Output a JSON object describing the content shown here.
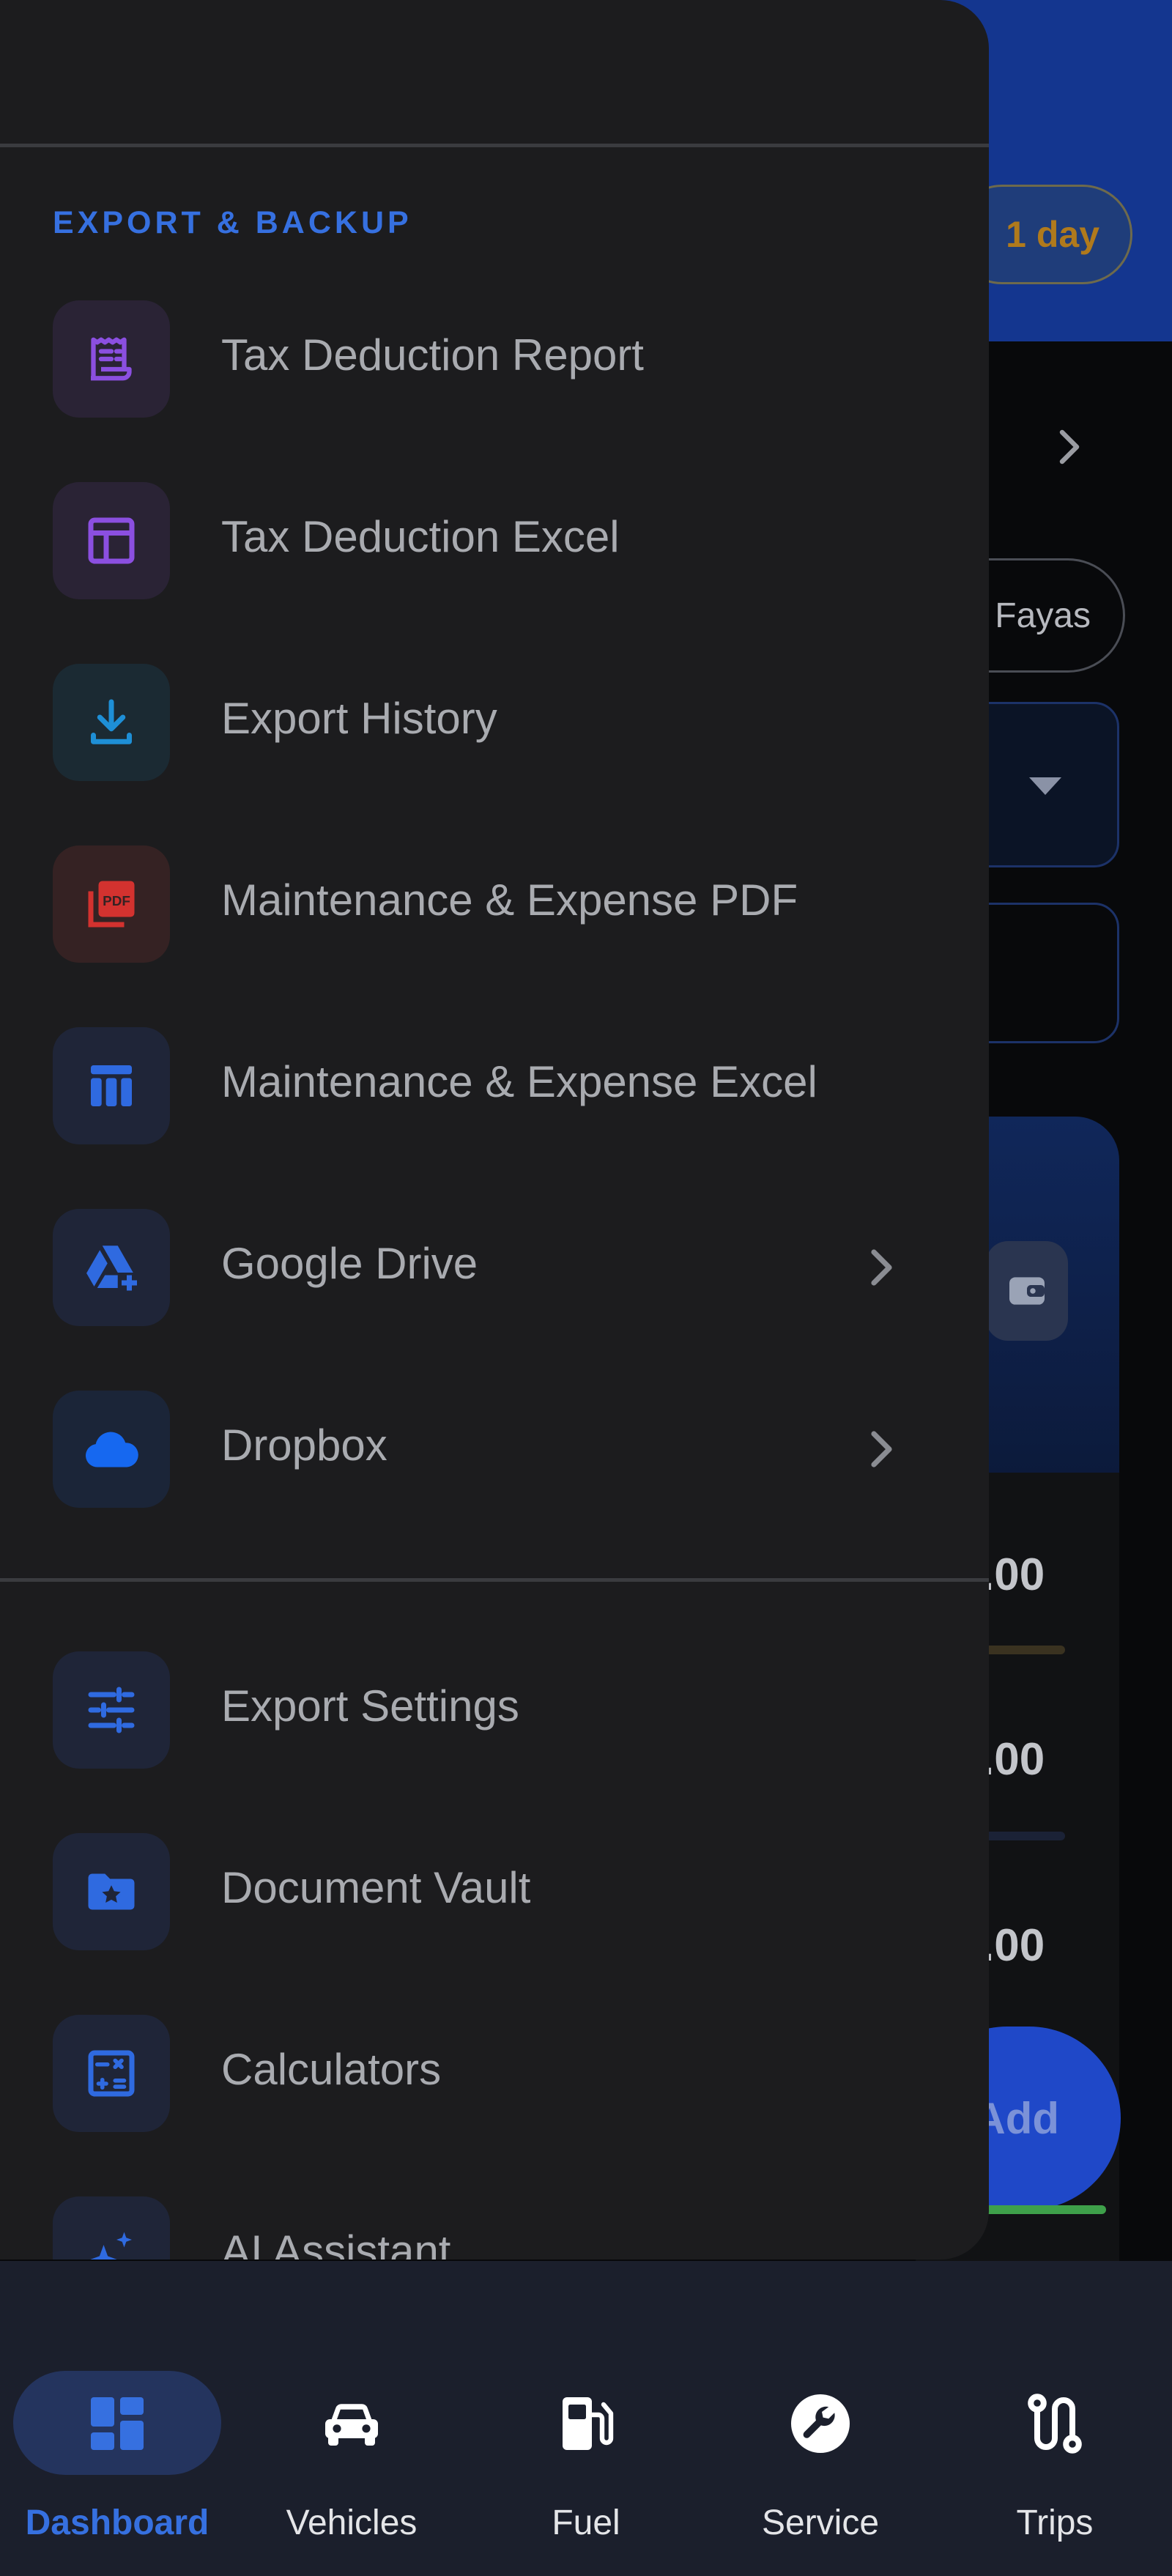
{
  "background": {
    "trial_badge": "1 day",
    "chip_label": "Fayas",
    "amounts": [
      ".00",
      ".00",
      ".00"
    ],
    "fab_label": "Add"
  },
  "drawer": {
    "section_title": "EXPORT & BACKUP",
    "export_items": [
      {
        "label": "Tax Deduction Report",
        "icon": "receipt-icon",
        "color": "#8b4fe0",
        "bg": "#2a2335"
      },
      {
        "label": "Tax Deduction Excel",
        "icon": "table-icon",
        "color": "#8b4fe0",
        "bg": "#2a2335"
      },
      {
        "label": "Export History",
        "icon": "download-icon",
        "color": "#1e8fd6",
        "bg": "#1b2a33"
      },
      {
        "label": "Maintenance & Expense PDF",
        "icon": "pdf-icon",
        "color": "#d3322f",
        "bg": "#352223"
      },
      {
        "label": "Maintenance & Expense Excel",
        "icon": "spreadsheet-icon",
        "color": "#2f6ae0",
        "bg": "#1f2538"
      },
      {
        "label": "Google Drive",
        "icon": "google-drive-icon",
        "color": "#2f6ae0",
        "bg": "#1f2538",
        "has_chevron": true
      },
      {
        "label": "Dropbox",
        "icon": "cloud-icon",
        "color": "#1668f0",
        "bg": "#1b2538",
        "has_chevron": true
      }
    ],
    "other_items": [
      {
        "label": "Export Settings",
        "icon": "sliders-icon",
        "color": "#2f6ae0",
        "bg": "#1f2538"
      },
      {
        "label": "Document Vault",
        "icon": "folder-star-icon",
        "color": "#2f6ae0",
        "bg": "#1f2538"
      },
      {
        "label": "Calculators",
        "icon": "calculator-icon",
        "color": "#2f6ae0",
        "bg": "#1f2538"
      },
      {
        "label": "AI Assistant",
        "icon": "sparkle-icon",
        "color": "#2f6ae0",
        "bg": "#1f2538"
      }
    ]
  },
  "bottom_nav": {
    "active_index": 0,
    "active_color": "#3670e0",
    "items": [
      {
        "label": "Dashboard",
        "icon": "dashboard-icon"
      },
      {
        "label": "Vehicles",
        "icon": "car-icon"
      },
      {
        "label": "Fuel",
        "icon": "fuel-pump-icon"
      },
      {
        "label": "Service",
        "icon": "wrench-icon"
      },
      {
        "label": "Trips",
        "icon": "route-icon"
      }
    ]
  }
}
